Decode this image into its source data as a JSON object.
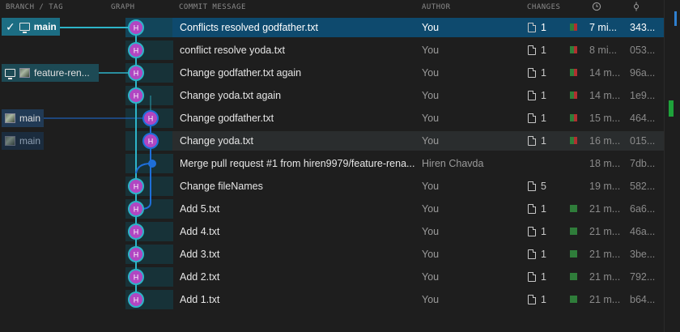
{
  "header": {
    "branch_tag": "BRANCH / TAG",
    "graph": "GRAPH",
    "commit_message": "COMMIT MESSAGE",
    "author": "AUTHOR",
    "changes": "CHANGES",
    "date_icon": "clock-icon",
    "sha_icon": "commit-icon",
    "settings_icon": "gear-icon"
  },
  "refs": {
    "main_selected": "main",
    "feature": "feature-ren...",
    "main_remote": "main",
    "main_dim": "main"
  },
  "avatar_initial": "H",
  "rows": [
    {
      "message": "Conflicts resolved godfather.txt",
      "author": "You",
      "changes": "1",
      "date": "7 mi...",
      "sha": "343...",
      "bar": {
        "added": 0.5,
        "removed": 0.5
      }
    },
    {
      "message": "conflict resolve yoda.txt",
      "author": "You",
      "changes": "1",
      "date": "8 mi...",
      "sha": "053...",
      "bar": {
        "added": 0.5,
        "removed": 0.5
      }
    },
    {
      "message": "Change godfather.txt again",
      "author": "You",
      "changes": "1",
      "date": "14 m...",
      "sha": "96a...",
      "bar": {
        "added": 0.5,
        "removed": 0.5
      }
    },
    {
      "message": "Change yoda.txt again",
      "author": "You",
      "changes": "1",
      "date": "14 m...",
      "sha": "1e9...",
      "bar": {
        "added": 0.5,
        "removed": 0.5
      }
    },
    {
      "message": "Change godfather.txt",
      "author": "You",
      "changes": "1",
      "date": "15 m...",
      "sha": "464...",
      "bar": {
        "added": 0.5,
        "removed": 0.5
      }
    },
    {
      "message": "Change yoda.txt",
      "author": "You",
      "changes": "1",
      "date": "16 m...",
      "sha": "015...",
      "bar": {
        "added": 0.5,
        "removed": 0.5
      }
    },
    {
      "message": "Merge pull request #1 from hiren9979/feature-rena...",
      "author": "Hiren Chavda",
      "changes": "",
      "date": "18 m...",
      "sha": "7db...",
      "bar": null
    },
    {
      "message": "Change fileNames",
      "author": "You",
      "changes": "5",
      "date": "19 m...",
      "sha": "582...",
      "bar": null
    },
    {
      "message": "Add 5.txt",
      "author": "You",
      "changes": "1",
      "date": "21 m...",
      "sha": "6a6...",
      "bar": {
        "added": 1.0,
        "removed": 0.0
      }
    },
    {
      "message": "Add 4.txt",
      "author": "You",
      "changes": "1",
      "date": "21 m...",
      "sha": "46a...",
      "bar": {
        "added": 1.0,
        "removed": 0.0
      }
    },
    {
      "message": "Add 3.txt",
      "author": "You",
      "changes": "1",
      "date": "21 m...",
      "sha": "3be...",
      "bar": {
        "added": 1.0,
        "removed": 0.0
      }
    },
    {
      "message": "Add 2.txt",
      "author": "You",
      "changes": "1",
      "date": "21 m...",
      "sha": "792...",
      "bar": {
        "added": 1.0,
        "removed": 0.0
      }
    },
    {
      "message": "Add 1.txt",
      "author": "You",
      "changes": "1",
      "date": "21 m...",
      "sha": "b64...",
      "bar": {
        "added": 1.0,
        "removed": 0.0
      }
    }
  ],
  "colors": {
    "lane_main": "#2db4c8",
    "lane_branch": "#1e6fd9",
    "node_fill": "#b146c2",
    "node_ring": "#2db4c8",
    "selected_row": "#0e4a6e",
    "added": "#2f7d3a",
    "removed": "#b03030"
  }
}
